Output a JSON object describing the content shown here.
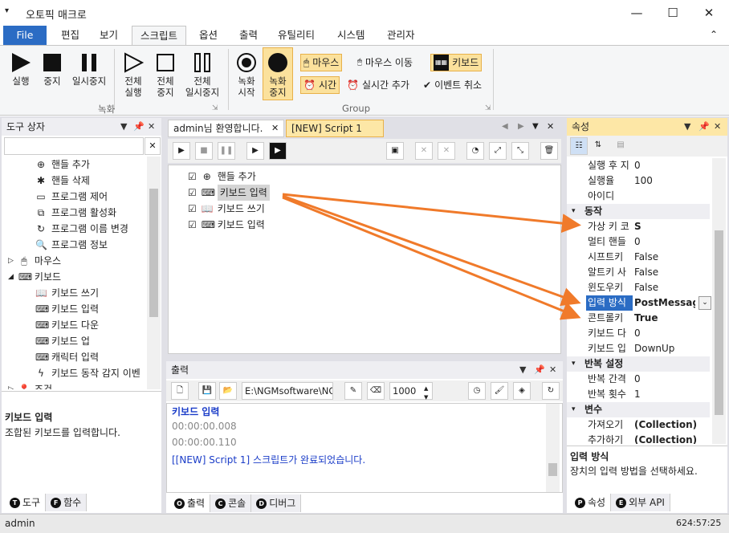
{
  "app": {
    "title": "오토픽 매크로",
    "menu_glyph": "▾",
    "min": "—",
    "max": "☐",
    "close": "✕"
  },
  "tabs": {
    "file": "File",
    "items": [
      "편집",
      "보기",
      "스크립트",
      "옵션",
      "출력",
      "유틸리티",
      "시스템",
      "관리자"
    ],
    "collapse": "⌃"
  },
  "ribbon": {
    "run": "실행",
    "stop": "중지",
    "pause": "일시중지",
    "all_run": [
      "전체",
      "실행"
    ],
    "all_stop": [
      "전체",
      "중지"
    ],
    "all_pause": [
      "전체",
      "일시중지"
    ],
    "rec_start": [
      "녹화",
      "시작"
    ],
    "rec_stop": [
      "녹화",
      "중지"
    ],
    "mouse": "마우스",
    "mouse_move": "마우스 이동",
    "keyboard": "키보드",
    "time": "시간",
    "realtime_add": "실시간 추가",
    "event_cancel": "이벤트 취소",
    "group_record": "녹화",
    "group_group": "Group"
  },
  "toolbox": {
    "title": "도구 상자",
    "items": [
      {
        "label": "핸들 추가",
        "icon": "crosshair-icon"
      },
      {
        "label": "핸들 삭제",
        "icon": "gear-icon"
      },
      {
        "label": "프로그램 제어",
        "icon": "monitor-icon"
      },
      {
        "label": "프로그램 활성화",
        "icon": "window-icon"
      },
      {
        "label": "프로그램 이름 변경",
        "icon": "refresh-icon"
      },
      {
        "label": "프로그램 정보",
        "icon": "search-icon"
      },
      {
        "label": "마우스",
        "icon": "mouse-icon"
      },
      {
        "label": "키보드",
        "icon": "keyboard-icon"
      },
      {
        "label": "키보드 쓰기",
        "icon": "book-icon"
      },
      {
        "label": "키보드 입력",
        "icon": "keyboard-icon"
      },
      {
        "label": "키보드 다운",
        "icon": "keyboard-down-icon"
      },
      {
        "label": "키보드 업",
        "icon": "keyboard-up-icon"
      },
      {
        "label": "캐릭터 입력",
        "icon": "keyboard-icon"
      },
      {
        "label": "키보드 동작 감지 이벤",
        "icon": "bolt-icon"
      },
      {
        "label": "조건",
        "icon": "pin-icon"
      }
    ],
    "desc_title": "키보드 입력",
    "desc_text": "조합된 키보드를 입력합니다.",
    "tabs": [
      "도구",
      "함수"
    ]
  },
  "docs": {
    "tab1": "admin님 환영합니다.",
    "tab2": "[NEW] Script 1",
    "script": [
      "핸들 추가",
      "키보드 입력",
      "키보드 쓰기",
      "키보드 입력"
    ]
  },
  "output": {
    "title": "출력",
    "path": "E:\\NGMsoftware\\NG",
    "interval": "1000",
    "lines": [
      "키보드 입력",
      "00:00:00.008",
      "00:00:00.110",
      "[[NEW] Script 1] 스크립트가 완료되었습니다."
    ],
    "tabs": [
      "출력",
      "콘솔",
      "디버그"
    ]
  },
  "props": {
    "title": "속성",
    "rows_top": [
      {
        "n": "실행 후 지",
        "v": "0"
      },
      {
        "n": "실행율",
        "v": "100"
      },
      {
        "n": "아이디",
        "v": ""
      }
    ],
    "cat_action": "동작",
    "rows_action": [
      {
        "n": "가상 키 코",
        "v": "S"
      },
      {
        "n": "멀티 핸들",
        "v": "0"
      },
      {
        "n": "시프트키",
        "v": "False"
      },
      {
        "n": "알트키 사",
        "v": "False"
      },
      {
        "n": "윈도우키",
        "v": "False"
      },
      {
        "n": "입력 방식",
        "v": "PostMessage"
      },
      {
        "n": "콘트롤키",
        "v": "True"
      },
      {
        "n": "키보드 다",
        "v": "0"
      },
      {
        "n": "키보드 입",
        "v": "DownUp"
      }
    ],
    "cat_repeat": "반복 설정",
    "rows_repeat": [
      {
        "n": "반복 간격",
        "v": "0"
      },
      {
        "n": "반복 횟수",
        "v": "1"
      }
    ],
    "cat_var": "변수",
    "rows_var": [
      {
        "n": "가져오기",
        "v": "(Collection)"
      },
      {
        "n": "추가하기",
        "v": "(Collection)"
      }
    ],
    "desc_title": "입력 방식",
    "desc_text": "장치의 입력 방법을 선택하세요.",
    "tabs": [
      "속성",
      "외부 API"
    ]
  },
  "status": {
    "user": "admin",
    "coords": "624:57:25"
  },
  "colors": {
    "accent": "#2b6cc4",
    "highlight": "#fbe19c",
    "arrow": "#f07a2a",
    "link": "#1a3cc8"
  }
}
